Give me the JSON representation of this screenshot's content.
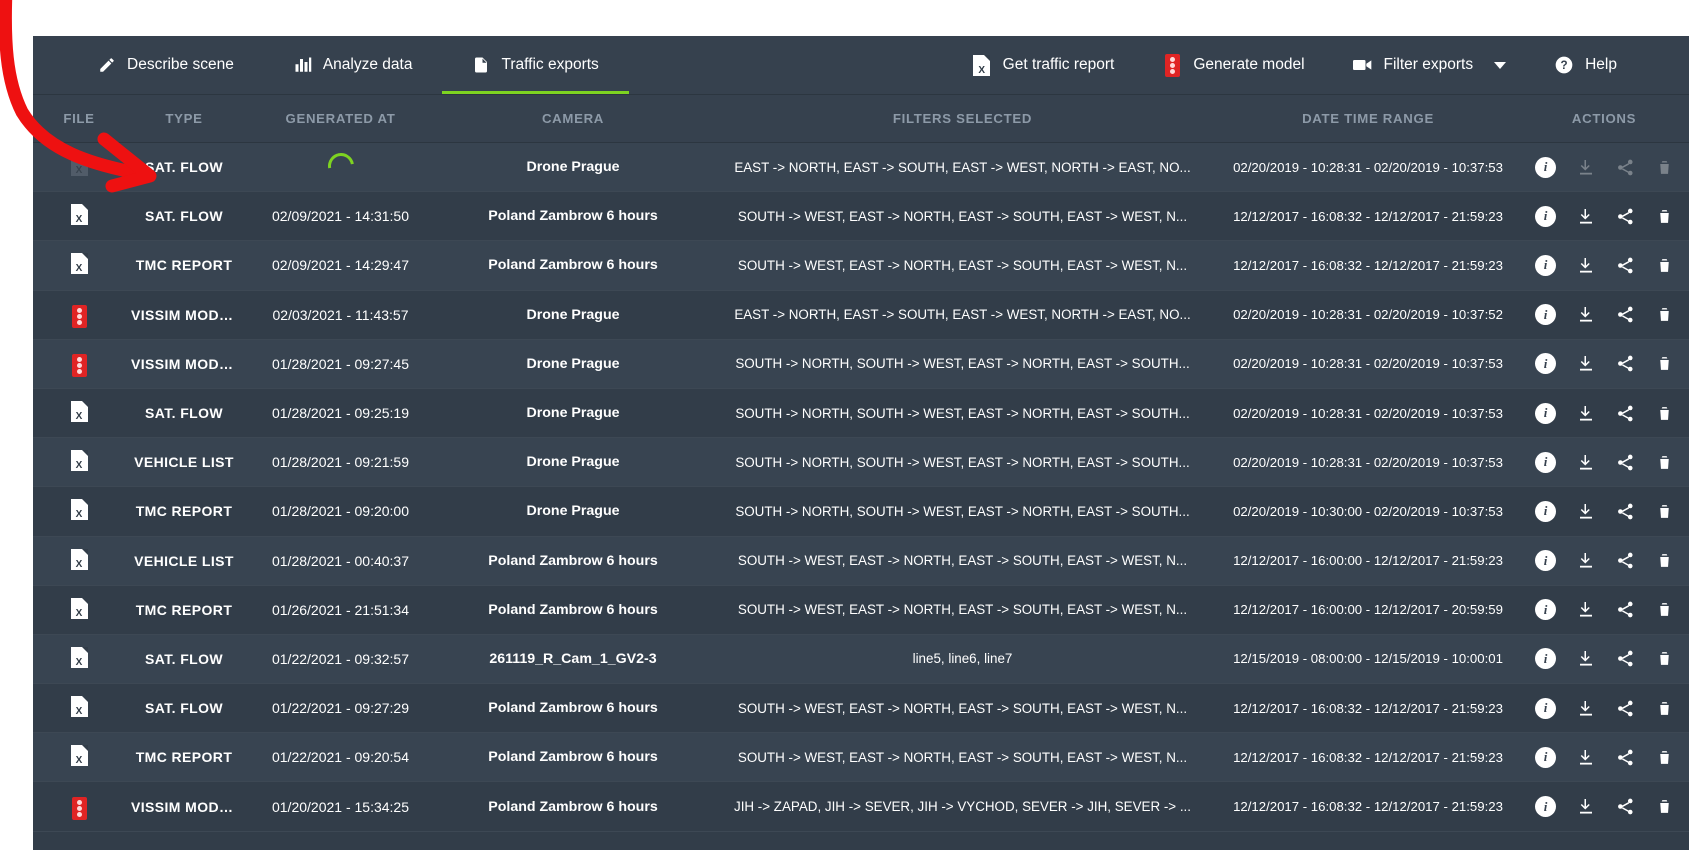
{
  "toolbar": {
    "tabs": [
      {
        "label": "Describe scene",
        "icon": "pencil-icon",
        "active": false
      },
      {
        "label": "Analyze data",
        "icon": "bar-chart-icon",
        "active": false
      },
      {
        "label": "Traffic exports",
        "icon": "document-icon",
        "active": true
      }
    ],
    "actions": [
      {
        "label": "Get traffic report",
        "icon": "excel-document-icon"
      },
      {
        "label": "Generate model",
        "icon": "traffic-light-icon"
      },
      {
        "label": "Filter exports",
        "icon": "video-camera-icon",
        "has_caret": true
      },
      {
        "label": "Help",
        "icon": "question-circle-icon"
      }
    ]
  },
  "colors": {
    "accent_green": "#7ed321",
    "panel_bg": "#323d49",
    "toolbar_bg": "#36414e",
    "row_bg": "#384451",
    "header_text": "#8d9aa8",
    "red": "#e02424",
    "annotation_red": "#ee1111"
  },
  "table": {
    "columns": [
      "FILE",
      "TYPE",
      "GENERATED AT",
      "CAMERA",
      "FILTERS SELECTED",
      "DATE TIME RANGE",
      "ACTIONS"
    ],
    "rows": [
      {
        "file_icon": "excel-document-icon-disabled",
        "type": "SAT. FLOW",
        "generated_at": "",
        "generating": true,
        "camera": "Drone Prague",
        "filters": "EAST -> NORTH, EAST -> SOUTH, EAST -> WEST, NORTH -> EAST, NO...",
        "range": "02/20/2019 - 10:28:31 - 02/20/2019 - 10:37:53",
        "actions_enabled": false
      },
      {
        "file_icon": "excel-document-icon",
        "type": "SAT. FLOW",
        "generated_at": "02/09/2021 - 14:31:50",
        "generating": false,
        "camera": "Poland Zambrow 6 hours",
        "filters": "SOUTH -> WEST, EAST -> NORTH, EAST -> SOUTH, EAST -> WEST, N...",
        "range": "12/12/2017 - 16:08:32 - 12/12/2017 - 21:59:23",
        "actions_enabled": true
      },
      {
        "file_icon": "excel-document-icon",
        "type": "TMC REPORT",
        "generated_at": "02/09/2021 - 14:29:47",
        "generating": false,
        "camera": "Poland Zambrow 6 hours",
        "filters": "SOUTH -> WEST, EAST -> NORTH, EAST -> SOUTH, EAST -> WEST, N...",
        "range": "12/12/2017 - 16:08:32 - 12/12/2017 - 21:59:23",
        "actions_enabled": true
      },
      {
        "file_icon": "traffic-light-icon",
        "type": "VISSIM MODEL",
        "generated_at": "02/03/2021 - 11:43:57",
        "generating": false,
        "camera": "Drone Prague",
        "filters": "EAST -> NORTH, EAST -> SOUTH, EAST -> WEST, NORTH -> EAST, NO...",
        "range": "02/20/2019 - 10:28:31 - 02/20/2019 - 10:37:52",
        "actions_enabled": true
      },
      {
        "file_icon": "traffic-light-icon",
        "type": "VISSIM MODEL",
        "generated_at": "01/28/2021 - 09:27:45",
        "generating": false,
        "camera": "Drone Prague",
        "filters": "SOUTH -> NORTH, SOUTH -> WEST, EAST -> NORTH, EAST -> SOUTH...",
        "range": "02/20/2019 - 10:28:31 - 02/20/2019 - 10:37:53",
        "actions_enabled": true
      },
      {
        "file_icon": "excel-document-icon",
        "type": "SAT. FLOW",
        "generated_at": "01/28/2021 - 09:25:19",
        "generating": false,
        "camera": "Drone Prague",
        "filters": "SOUTH -> NORTH, SOUTH -> WEST, EAST -> NORTH, EAST -> SOUTH...",
        "range": "02/20/2019 - 10:28:31 - 02/20/2019 - 10:37:53",
        "actions_enabled": true
      },
      {
        "file_icon": "excel-document-icon",
        "type": "VEHICLE LIST",
        "generated_at": "01/28/2021 - 09:21:59",
        "generating": false,
        "camera": "Drone Prague",
        "filters": "SOUTH -> NORTH, SOUTH -> WEST, EAST -> NORTH, EAST -> SOUTH...",
        "range": "02/20/2019 - 10:28:31 - 02/20/2019 - 10:37:53",
        "actions_enabled": true
      },
      {
        "file_icon": "excel-document-icon",
        "type": "TMC REPORT",
        "generated_at": "01/28/2021 - 09:20:00",
        "generating": false,
        "camera": "Drone Prague",
        "filters": "SOUTH -> NORTH, SOUTH -> WEST, EAST -> NORTH, EAST -> SOUTH...",
        "range": "02/20/2019 - 10:30:00 - 02/20/2019 - 10:37:53",
        "actions_enabled": true
      },
      {
        "file_icon": "excel-document-icon",
        "type": "VEHICLE LIST",
        "generated_at": "01/28/2021 - 00:40:37",
        "generating": false,
        "camera": "Poland Zambrow 6 hours",
        "filters": "SOUTH -> WEST, EAST -> NORTH, EAST -> SOUTH, EAST -> WEST, N...",
        "range": "12/12/2017 - 16:00:00 - 12/12/2017 - 21:59:23",
        "actions_enabled": true
      },
      {
        "file_icon": "excel-document-icon",
        "type": "TMC REPORT",
        "generated_at": "01/26/2021 - 21:51:34",
        "generating": false,
        "camera": "Poland Zambrow 6 hours",
        "filters": "SOUTH -> WEST, EAST -> NORTH, EAST -> SOUTH, EAST -> WEST, N...",
        "range": "12/12/2017 - 16:00:00 - 12/12/2017 - 20:59:59",
        "actions_enabled": true
      },
      {
        "file_icon": "excel-document-icon",
        "type": "SAT. FLOW",
        "generated_at": "01/22/2021 - 09:32:57",
        "generating": false,
        "camera": "261119_R_Cam_1_GV2-3",
        "filters": "line5, line6, line7",
        "range": "12/15/2019 - 08:00:00 - 12/15/2019 - 10:00:01",
        "actions_enabled": true
      },
      {
        "file_icon": "excel-document-icon",
        "type": "SAT. FLOW",
        "generated_at": "01/22/2021 - 09:27:29",
        "generating": false,
        "camera": "Poland Zambrow 6 hours",
        "filters": "SOUTH -> WEST, EAST -> NORTH, EAST -> SOUTH, EAST -> WEST, N...",
        "range": "12/12/2017 - 16:08:32 - 12/12/2017 - 21:59:23",
        "actions_enabled": true
      },
      {
        "file_icon": "excel-document-icon",
        "type": "TMC REPORT",
        "generated_at": "01/22/2021 - 09:20:54",
        "generating": false,
        "camera": "Poland Zambrow 6 hours",
        "filters": "SOUTH -> WEST, EAST -> NORTH, EAST -> SOUTH, EAST -> WEST, N...",
        "range": "12/12/2017 - 16:08:32 - 12/12/2017 - 21:59:23",
        "actions_enabled": true
      },
      {
        "file_icon": "traffic-light-icon",
        "type": "VISSIM MODEL",
        "generated_at": "01/20/2021 - 15:34:25",
        "generating": false,
        "camera": "Poland Zambrow 6 hours",
        "filters": "JIH -> ZAPAD, JIH -> SEVER, JIH -> VYCHOD, SEVER -> JIH, SEVER -> ...",
        "range": "12/12/2017 - 16:08:32 - 12/12/2017 - 21:59:23",
        "actions_enabled": true
      }
    ],
    "row_action_icons": [
      "info-icon",
      "download-icon",
      "share-icon",
      "trash-icon"
    ]
  },
  "annotation": {
    "type": "red-arrow",
    "points_to": "first-row-file-cell"
  }
}
